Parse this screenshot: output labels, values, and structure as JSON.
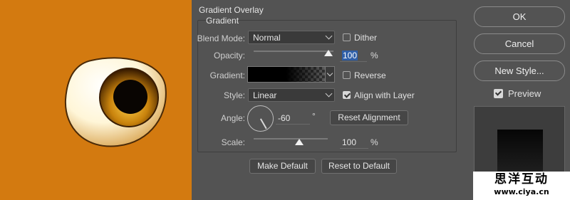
{
  "colors": {
    "canvas_bg": "#d37a10",
    "dialog_bg": "#535353",
    "selection": "#2f5fa8"
  },
  "dialog": {
    "group_title": "Gradient Overlay",
    "subgroup_title": "Gradient",
    "blend_mode": {
      "label": "Blend Mode:",
      "value": "Normal"
    },
    "dither": {
      "label": "Dither",
      "checked": false
    },
    "opacity": {
      "label": "Opacity:",
      "value": "100",
      "unit": "%",
      "level": 1.0
    },
    "gradient": {
      "label": "Gradient:",
      "preview": "black-to-transparent"
    },
    "reverse": {
      "label": "Reverse",
      "checked": false
    },
    "style": {
      "label": "Style:",
      "value": "Linear"
    },
    "align_with_layer": {
      "label": "Align with Layer",
      "checked": true
    },
    "angle": {
      "label": "Angle:",
      "value": "-60",
      "unit": "°"
    },
    "reset_alignment": "Reset Alignment",
    "scale": {
      "label": "Scale:",
      "value": "100",
      "unit": "%",
      "level": 0.45
    },
    "make_default": "Make Default",
    "reset_to_default": "Reset to Default"
  },
  "actions": {
    "ok": "OK",
    "cancel": "Cancel",
    "new_style": "New Style...",
    "preview": {
      "label": "Preview",
      "checked": true
    }
  },
  "watermark": {
    "line1": "思洋互动",
    "line2": "www.ciya.cn"
  }
}
